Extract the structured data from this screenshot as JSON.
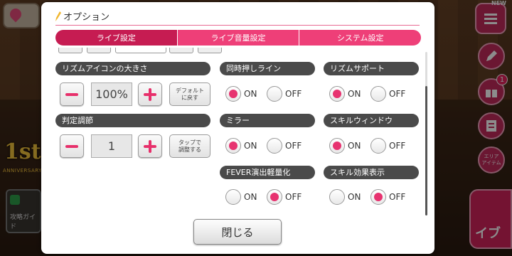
{
  "dialog": {
    "title": "オプション",
    "tabs": [
      {
        "label": "ライブ設定",
        "active": true
      },
      {
        "label": "ライブ音量設定",
        "active": false
      },
      {
        "label": "システム設定",
        "active": false
      }
    ],
    "icon_size": {
      "label": "リズムアイコンの大きさ",
      "value": "100%",
      "reset_label": "デフォルト\nに戻す"
    },
    "judgement": {
      "label": "判定調節",
      "value": "1",
      "tap_label": "タップで\n調整する"
    },
    "toggles": [
      {
        "label": "同時押しライン",
        "on_label": "ON",
        "off_label": "OFF",
        "state": "on"
      },
      {
        "label": "リズムサポート",
        "on_label": "ON",
        "off_label": "OFF",
        "state": "on"
      },
      {
        "label": "ミラー",
        "on_label": "ON",
        "off_label": "OFF",
        "state": "on"
      },
      {
        "label": "スキルウィンドウ",
        "on_label": "ON",
        "off_label": "OFF",
        "state": "on"
      },
      {
        "label": "FEVER演出軽量化",
        "on_label": "ON",
        "off_label": "OFF",
        "state": "off"
      },
      {
        "label": "スキル効果表示",
        "on_label": "ON",
        "off_label": "OFF",
        "state": "off"
      }
    ],
    "close_label": "閉じる"
  },
  "background": {
    "menu_new_badge": "NEW",
    "gift_badge_count": "1",
    "area_label": "エリア\nアイテム",
    "guide_label": "攻略ガイド",
    "anniversary_number": "1st",
    "anniversary_label": "ANNIVERSARY",
    "live_label": "イブ"
  },
  "colors": {
    "accent": "#e7306b",
    "tab_active": "#c61c52",
    "tab_inactive": "#ee3f78",
    "section_label_bg": "#4a4a4a"
  }
}
